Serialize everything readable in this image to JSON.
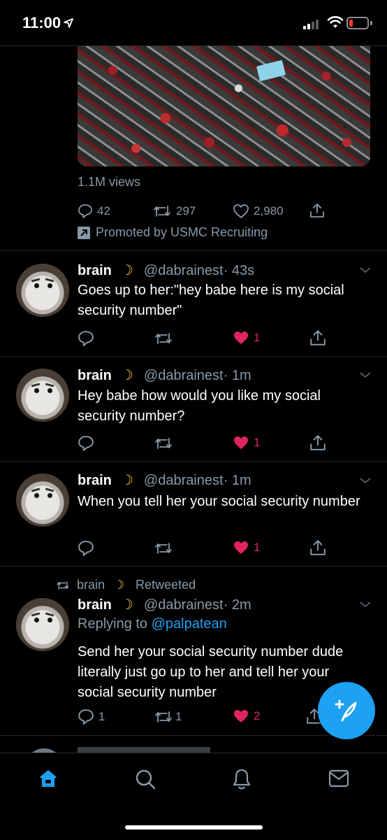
{
  "status_bar": {
    "time": "11:00"
  },
  "promoted_tweet": {
    "views": "1.1M views",
    "reply_count": "42",
    "retweet_count": "297",
    "like_count": "2,980",
    "promoted_label": "Promoted by USMC Recruiting"
  },
  "tweets": [
    {
      "name": "brain",
      "handle": "@dabrainest",
      "time": "· 43s",
      "text": "Goes up to her:\"hey babe here is my social security number\"",
      "likes": "1"
    },
    {
      "name": "brain",
      "handle": "@dabrainest",
      "time": "· 1m",
      "text": "Hey babe how would you like my social security number?",
      "likes": "1"
    },
    {
      "name": "brain",
      "handle": "@dabrainest",
      "time": "· 1m",
      "text": "When you tell her your social security number",
      "likes": "1"
    },
    {
      "retweeted_by": "brain",
      "retweeted_label": "Retweeted",
      "name": "brain",
      "handle": "@dabrainest",
      "time": "· 2m",
      "replying_to_label": "Replying to",
      "replying_to_handle": "@palpatean",
      "text": "Send her your social security number dude literally just go up to her and tell her your social security number",
      "replies": "1",
      "retweets": "1",
      "likes": "2"
    }
  ],
  "colors": {
    "accent": "#1da1f2",
    "like": "#e0245e",
    "muted": "#8899a6",
    "background": "#000000"
  },
  "tab_bar": {
    "items": [
      {
        "name": "Home",
        "icon": "home-icon",
        "active": true
      },
      {
        "name": "Search",
        "icon": "search-icon",
        "active": false
      },
      {
        "name": "Notifications",
        "icon": "bell-icon",
        "active": false
      },
      {
        "name": "Messages",
        "icon": "mail-icon",
        "active": false
      }
    ]
  }
}
